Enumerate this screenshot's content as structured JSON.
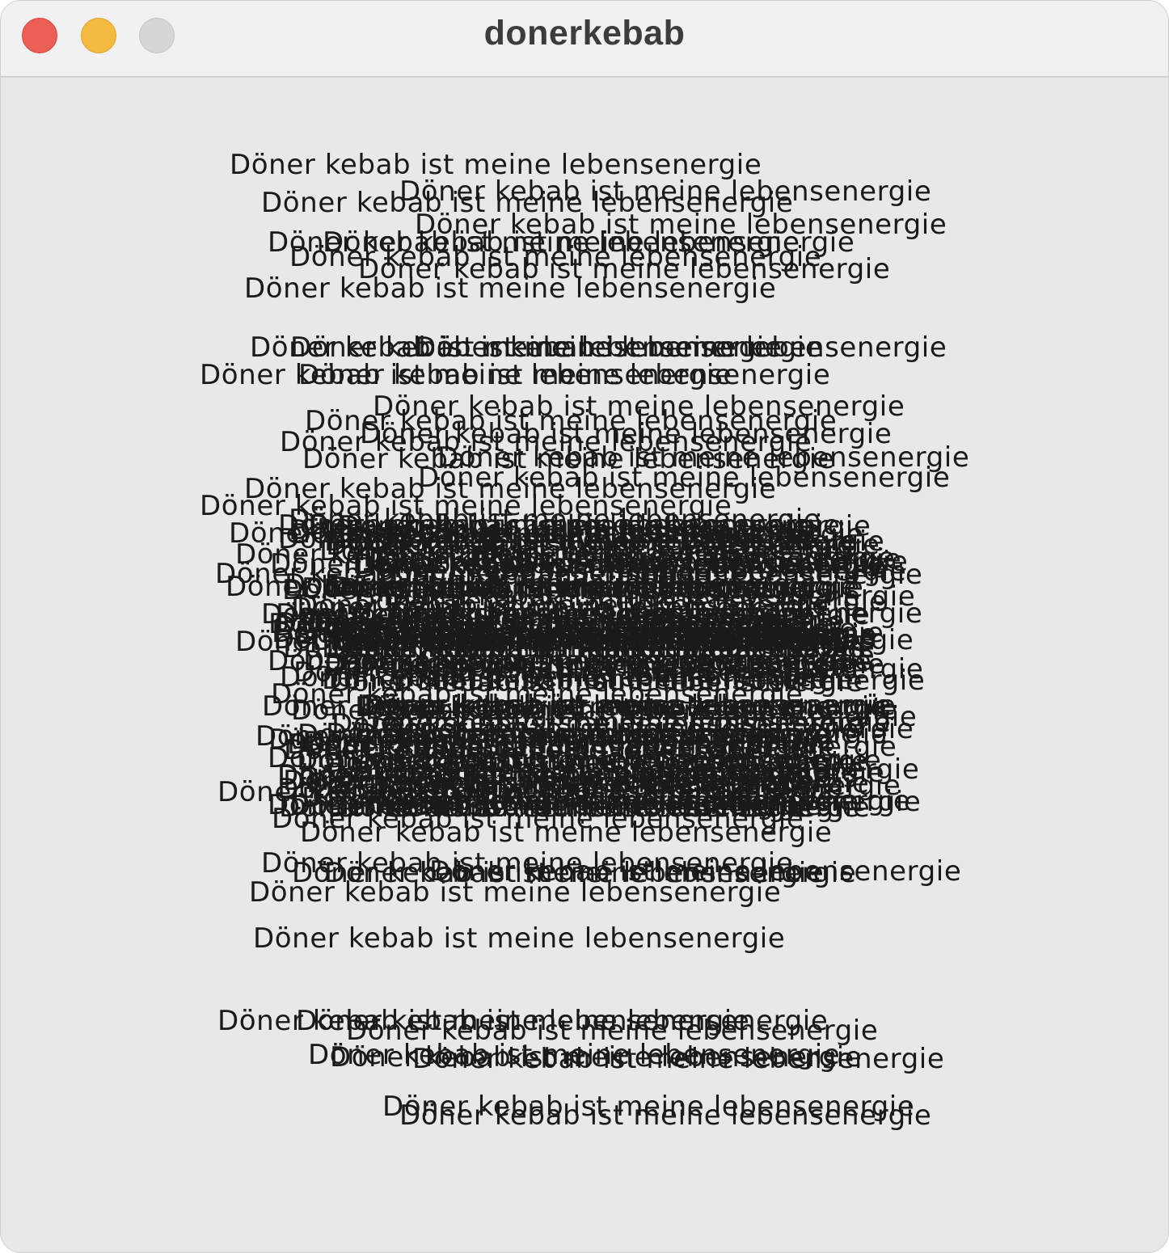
{
  "window": {
    "title": "donerkebab"
  },
  "canvas": {
    "text": "Döner kebab ist meine lebensenergie"
  },
  "colors": {
    "close": "#ec5f57",
    "minimize": "#f4bb40",
    "zoom": "#d6d6d6",
    "background": "#e8e8e8",
    "text": "#1a1a1a"
  }
}
